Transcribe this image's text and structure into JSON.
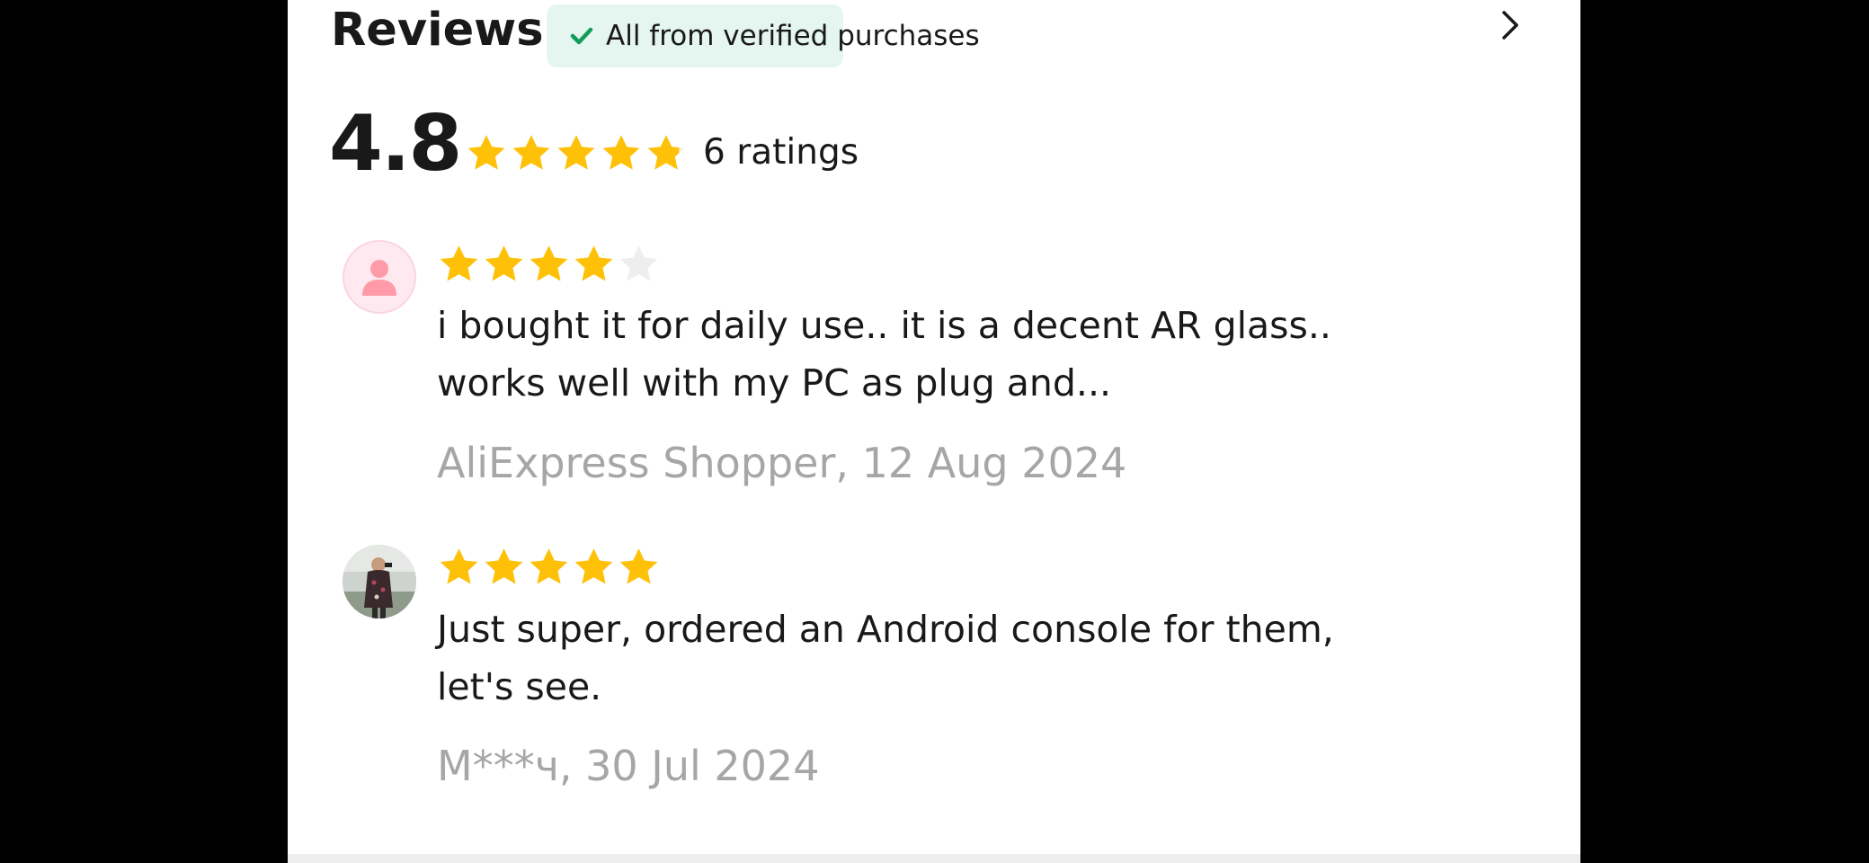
{
  "header": {
    "title": "Reviews",
    "verified_badge": "All from verified purchases",
    "check_icon": "check-icon",
    "more_icon": "chevron-right-icon",
    "badge_color": "#e5f5ef",
    "check_color": "#0f9d58"
  },
  "summary": {
    "score": "4.8",
    "rating_value": 4.8,
    "rating_max": 5,
    "count_label": "6 ratings",
    "star_color": "#ffc107",
    "empty_star_color": "#eeeeee"
  },
  "reviews": [
    {
      "stars": 4,
      "avatar_icon": "default-user-avatar",
      "text": "i bought it for daily use.. it is a decent AR glass.. works well with my PC as plug and...",
      "author_date": "AliExpress Shopper, 12 Aug 2024"
    },
    {
      "stars": 5,
      "avatar_icon": "user-photo-avatar",
      "text": "Just super, ordered an Android console for them, let's see.",
      "author_date": "M***ч, 30 Jul 2024"
    }
  ]
}
